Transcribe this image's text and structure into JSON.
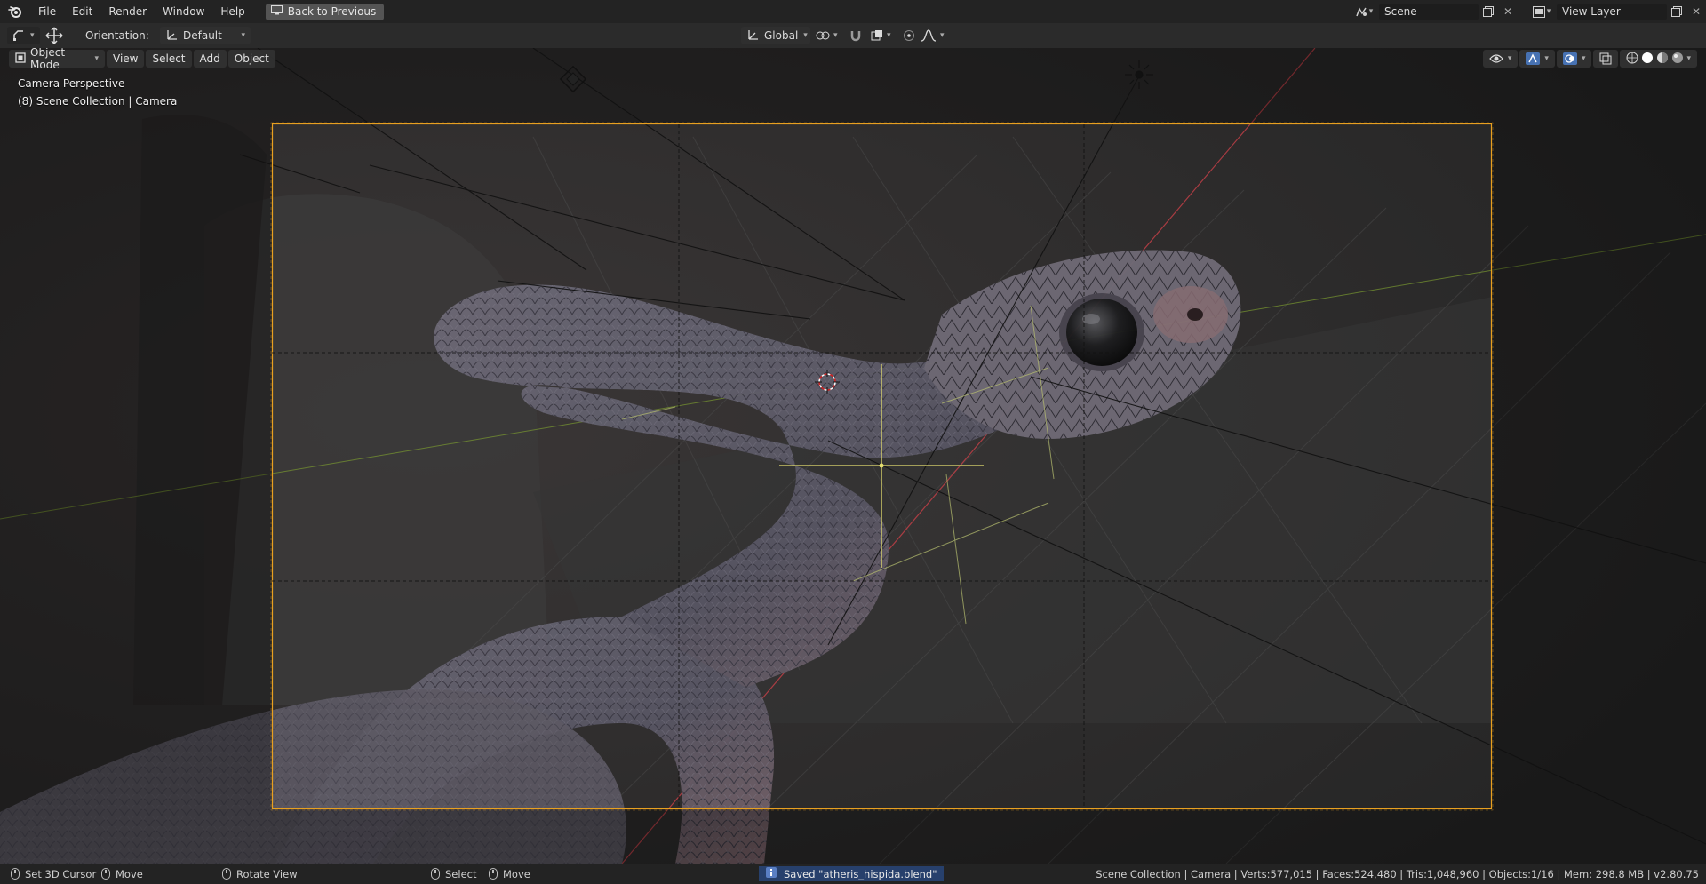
{
  "topbar": {
    "logo_icon": "blender-logo-icon",
    "menus": [
      "File",
      "Edit",
      "Render",
      "Window",
      "Help"
    ],
    "back_button": "Back to Previous",
    "scene_name": "Scene",
    "view_layer_name": "View Layer"
  },
  "toolbar": {
    "orientation_label": "Orientation:",
    "orientation_value": "Default",
    "transform_orientation": "Global"
  },
  "viewport": {
    "mode": "Object Mode",
    "menus": [
      "View",
      "Select",
      "Add",
      "Object"
    ],
    "view_name": "Camera Perspective",
    "collection_info": "(8) Scene Collection | Camera",
    "colors": {
      "camera_frame": "#e8a020",
      "x_axis": "#c84048",
      "y_axis": "#7a9a30",
      "background": "#313131"
    }
  },
  "statusbar": {
    "hints": [
      {
        "icon": "mouse-left-icon",
        "label": "Set 3D Cursor"
      },
      {
        "icon": "mouse-middle-icon",
        "label": "Move"
      },
      {
        "icon": "mouse-middle-icon",
        "label": "Rotate View"
      },
      {
        "icon": "mouse-left-icon",
        "label": "Select"
      },
      {
        "icon": "mouse-left-icon",
        "label": "Move"
      }
    ],
    "saved_message": "Saved \"atheris_hispida.blend\"",
    "stats": "Scene Collection | Camera | Verts:577,015 | Faces:524,480 | Tris:1,048,960 | Objects:1/16 | Mem: 298.8 MB | v2.80.75"
  }
}
